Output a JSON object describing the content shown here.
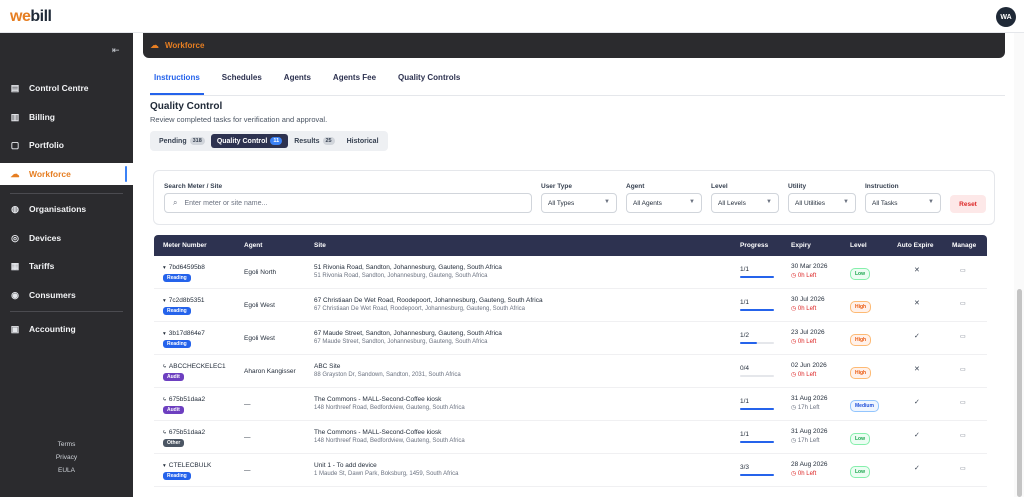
{
  "app": {
    "logo_prefix": "we",
    "logo_suffix": "bill",
    "user_initials": "WA"
  },
  "sidebar": {
    "items": [
      {
        "label": "Control Centre",
        "icon": "clipboard-icon"
      },
      {
        "label": "Billing",
        "icon": "receipt-icon"
      },
      {
        "label": "Portfolio",
        "icon": "document-icon"
      },
      {
        "label": "Workforce",
        "icon": "cloud-icon",
        "active": true
      },
      {
        "label": "Organisations",
        "icon": "globe-icon"
      },
      {
        "label": "Devices",
        "icon": "target-icon"
      },
      {
        "label": "Tariffs",
        "icon": "file-icon"
      },
      {
        "label": "Consumers",
        "icon": "user-icon"
      },
      {
        "label": "Accounting",
        "icon": "calculator-icon"
      }
    ],
    "footer": [
      "Terms",
      "Privacy",
      "EULA"
    ]
  },
  "header": {
    "title": "Workforce"
  },
  "tabs": [
    "Instructions",
    "Schedules",
    "Agents",
    "Agents Fee",
    "Quality Controls"
  ],
  "section": {
    "title": "Quality Control",
    "subtitle": "Review completed tasks for verification and approval."
  },
  "subtabs": [
    {
      "label": "Pending",
      "count": "318"
    },
    {
      "label": "Quality Control",
      "count": "11",
      "active": true
    },
    {
      "label": "Results",
      "count": "25"
    },
    {
      "label": "Historical",
      "count": ""
    }
  ],
  "filters": {
    "search_label": "Search Meter / Site",
    "search_placeholder": "Enter meter or site name...",
    "user_type_label": "User Type",
    "user_type_value": "All Types",
    "agent_label": "Agent",
    "agent_value": "All Agents",
    "level_label": "Level",
    "level_value": "All Levels",
    "utility_label": "Utility",
    "utility_value": "All Utilities",
    "instruction_label": "Instruction",
    "instruction_value": "All Tasks",
    "reset_label": "Reset"
  },
  "table": {
    "headers": [
      "Meter Number",
      "Agent",
      "Site",
      "Progress",
      "Expiry",
      "Level",
      "Auto Expire",
      "Manage"
    ],
    "rows": [
      {
        "meter": "7bd64595b8",
        "type": "Reading",
        "agent": "Egoli North",
        "site": "51 Rivonia Road, Sandton, Johannesburg, Gauteng, South Africa",
        "address": "51 Rivonia Road, Sandton, Johannesburg, Gauteng, South Africa",
        "progress": "1/1",
        "fill": 1.0,
        "expiry": "30 Mar 2026",
        "left": "0h Left",
        "level": "Low",
        "auto": "✕"
      },
      {
        "meter": "7c2d8b5351",
        "type": "Reading",
        "agent": "Egoli West",
        "site": "67 Christiaan De Wet Road, Roodepoort, Johannesburg, Gauteng, South Africa",
        "address": "67 Christiaan De Wet Road, Roodepoort, Johannesburg, Gauteng, South Africa",
        "progress": "1/1",
        "fill": 1.0,
        "expiry": "30 Jul 2026",
        "left": "0h Left",
        "level": "High",
        "auto": "✕"
      },
      {
        "meter": "3b17d864e7",
        "type": "Reading",
        "agent": "Egoli West",
        "site": "67 Maude Street, Sandton, Johannesburg, Gauteng, South Africa",
        "address": "67 Maude Street, Sandton, Johannesburg, Gauteng, South Africa",
        "progress": "1/2",
        "fill": 0.5,
        "expiry": "23 Jul 2026",
        "left": "0h Left",
        "level": "High",
        "auto": "✓"
      },
      {
        "meter": "ABCCHECKELEC1",
        "type": "Audit",
        "agent": "Aharon Kangisser",
        "site": "ABC Site",
        "address": "88 Grayston Dr, Sandown, Sandton, 2031, South Africa",
        "progress": "0/4",
        "fill": 0.0,
        "expiry": "02 Jun 2026",
        "left": "0h Left",
        "level": "High",
        "auto": "✕"
      },
      {
        "meter": "675b51daa2",
        "type": "Audit",
        "agent": "—",
        "site": "The Commons - MALL-Second-Coffee kiosk",
        "address": "148 Northreef Road, Bedfordview, Gauteng, South Africa",
        "progress": "1/1",
        "fill": 1.0,
        "expiry": "31 Aug 2026",
        "left": "17h Left",
        "level": "Medium",
        "auto": "✓"
      },
      {
        "meter": "675b51daa2",
        "type": "Other",
        "agent": "—",
        "site": "The Commons - MALL-Second-Coffee kiosk",
        "address": "148 Northreef Road, Bedfordview, Gauteng, South Africa",
        "progress": "1/1",
        "fill": 1.0,
        "expiry": "31 Aug 2026",
        "left": "17h Left",
        "level": "Low",
        "auto": "✓"
      },
      {
        "meter": "CTELECBULK",
        "type": "Reading",
        "agent": "—",
        "site": "Unit 1 - To add device",
        "address": "1 Maude St, Dawn Park, Boksburg, 1459, South Africa",
        "progress": "3/3",
        "fill": 1.0,
        "expiry": "28 Aug 2026",
        "left": "0h Left",
        "level": "Low",
        "auto": "✓"
      }
    ]
  },
  "colors": {
    "accent": "#e67e22",
    "navy": "#2d3250",
    "blue": "#2563eb"
  }
}
